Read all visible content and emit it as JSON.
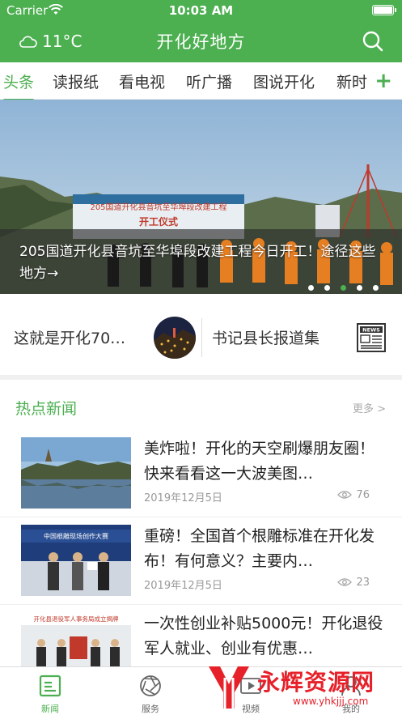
{
  "status_bar": {
    "carrier": "Carrier",
    "time": "10:03 AM"
  },
  "header": {
    "weather": "11°C",
    "title": "开化好地方"
  },
  "tabs": [
    "头条",
    "读报纸",
    "看电视",
    "听广播",
    "图说开化",
    "新时"
  ],
  "tabs_active_index": 0,
  "banner": {
    "title": "205国道开化县音坑至华埠段改建工程今日开工！途径这些地方→",
    "sign_text": "205国道开化县音坑至华埠段改建工程",
    "sign_sub": "开工仪式",
    "slide_count": 5,
    "active_slide": 3
  },
  "shortcuts": {
    "left_label": "这就是开化70…",
    "right_label": "书记县长报道集",
    "news_icon_text": "NEWS"
  },
  "hot_news": {
    "title": "热点新闻",
    "more": "更多 >",
    "items": [
      {
        "headline": "美炸啦！开化的天空刷爆朋友圈！快来看看这一大波美图…",
        "date": "2019年12月5日",
        "views": "76"
      },
      {
        "headline": "重磅！全国首个根雕标准在开化发布！有何意义？主要内…",
        "date": "2019年12月5日",
        "views": "23"
      },
      {
        "headline": "一次性创业补贴5000元！开化退役军人就业、创业有优惠…",
        "date": "",
        "views": ""
      }
    ],
    "thumb2_text": "中国根雕现场创作大赛",
    "thumb3_text": "开化县退役军人事务局成立揭牌"
  },
  "tabbar": {
    "items": [
      "新闻",
      "服务",
      "视频",
      "我的"
    ],
    "active": 0
  },
  "watermark": {
    "text": "永辉资源网",
    "url": "www.yhkjjj.com"
  },
  "colors": {
    "primary": "#4CAF50",
    "watermark": "#e6212a"
  }
}
